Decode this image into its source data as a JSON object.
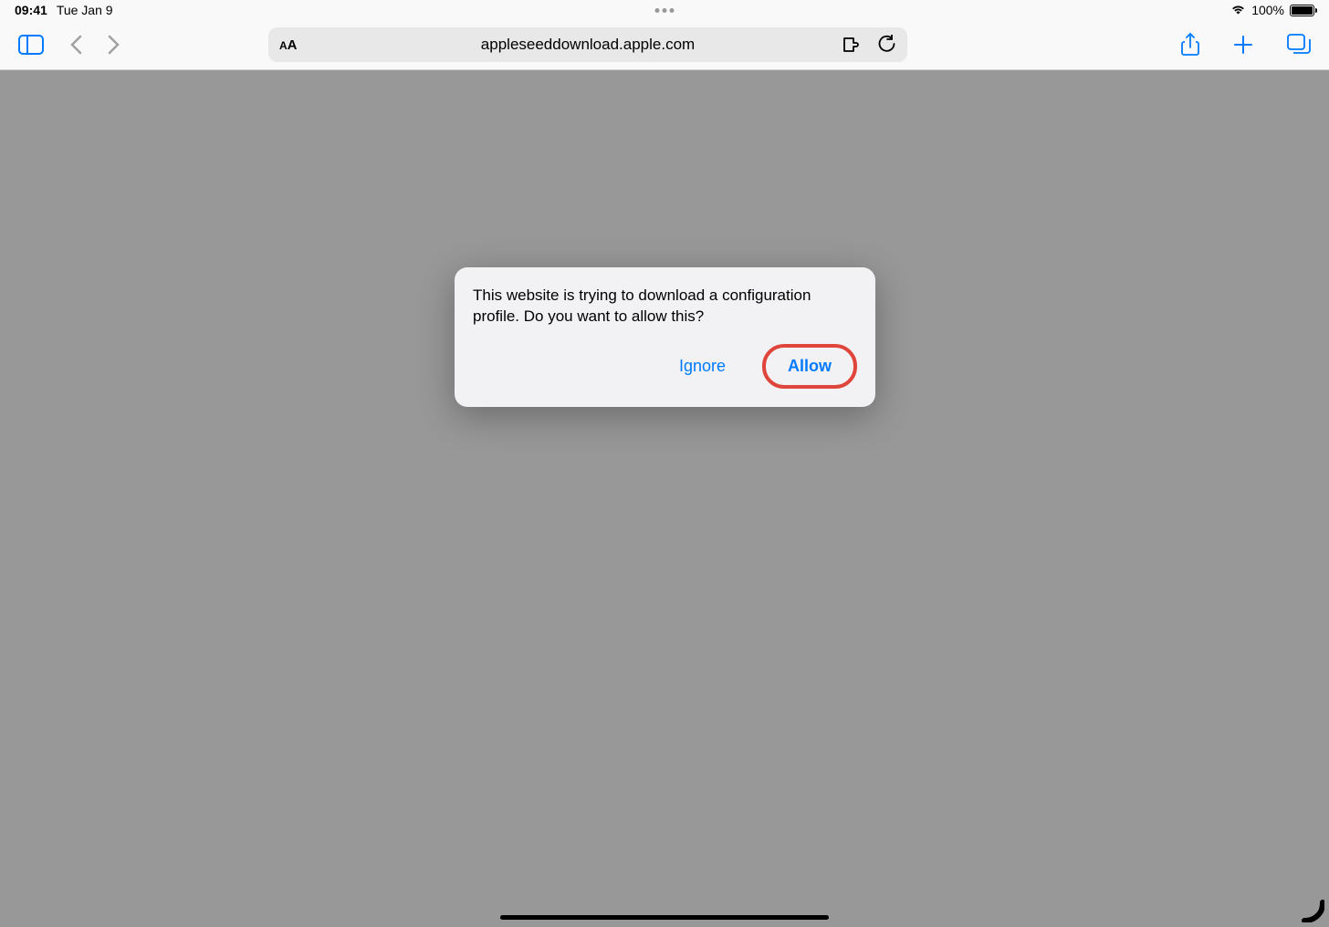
{
  "statusBar": {
    "time": "09:41",
    "date": "Tue Jan 9",
    "batteryPercent": "100%"
  },
  "toolbar": {
    "url": "appleseeddownload.apple.com"
  },
  "dialog": {
    "message": "This website is trying to download a configuration profile. Do you want to allow this?",
    "ignoreLabel": "Ignore",
    "allowLabel": "Allow"
  },
  "colors": {
    "accent": "#007aff",
    "highlight": "#e0453b"
  }
}
